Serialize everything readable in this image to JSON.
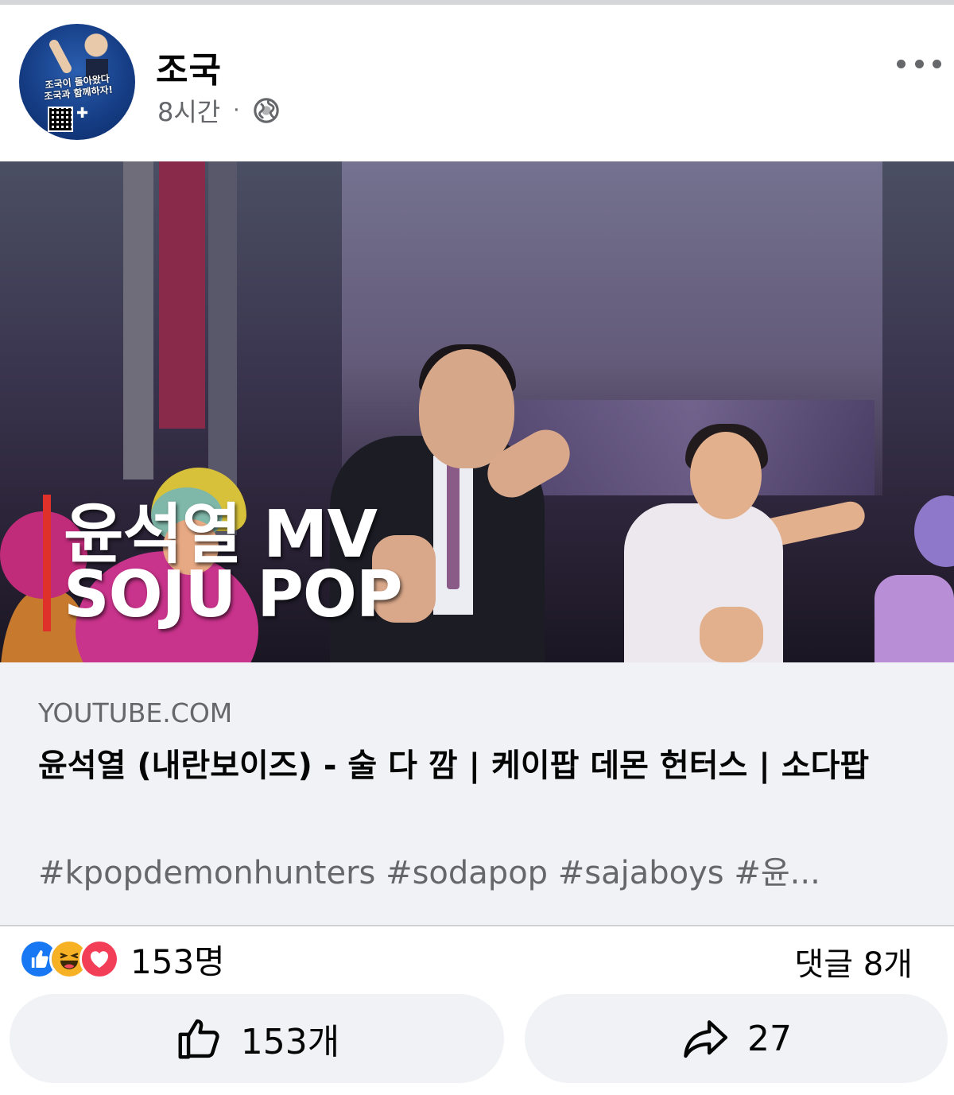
{
  "post": {
    "author": "조국",
    "time": "8시간",
    "separator": "·",
    "privacy_icon": "globe-icon",
    "more_icon": "more-options-icon",
    "avatar_text": "조국이 돌아왔다\n조국과 함께하자!"
  },
  "video": {
    "overlay_line1": "윤석열 MV",
    "overlay_line2": "SOJU POP"
  },
  "link_card": {
    "domain": "YOUTUBE.COM",
    "title": "윤석열 (내란보이즈) - 술 다 깜 | 케이팝 데몬 헌터스 | 소다팝",
    "description": "#kpopdemonhunters #sodapop #sajaboys #윤..."
  },
  "stats": {
    "reaction_icons": [
      "like-icon",
      "haha-icon",
      "love-icon"
    ],
    "reactions_count": "153명",
    "comments": "댓글 8개"
  },
  "actions": {
    "like_count": "153개",
    "share_count": "27"
  },
  "colors": {
    "like_blue": "#1877f2",
    "love_red": "#f33e58",
    "haha_yellow": "#f7b125",
    "overlay_bar": "#e0302a",
    "secondary_text": "#65676b",
    "card_bg": "#f0f2f5"
  }
}
